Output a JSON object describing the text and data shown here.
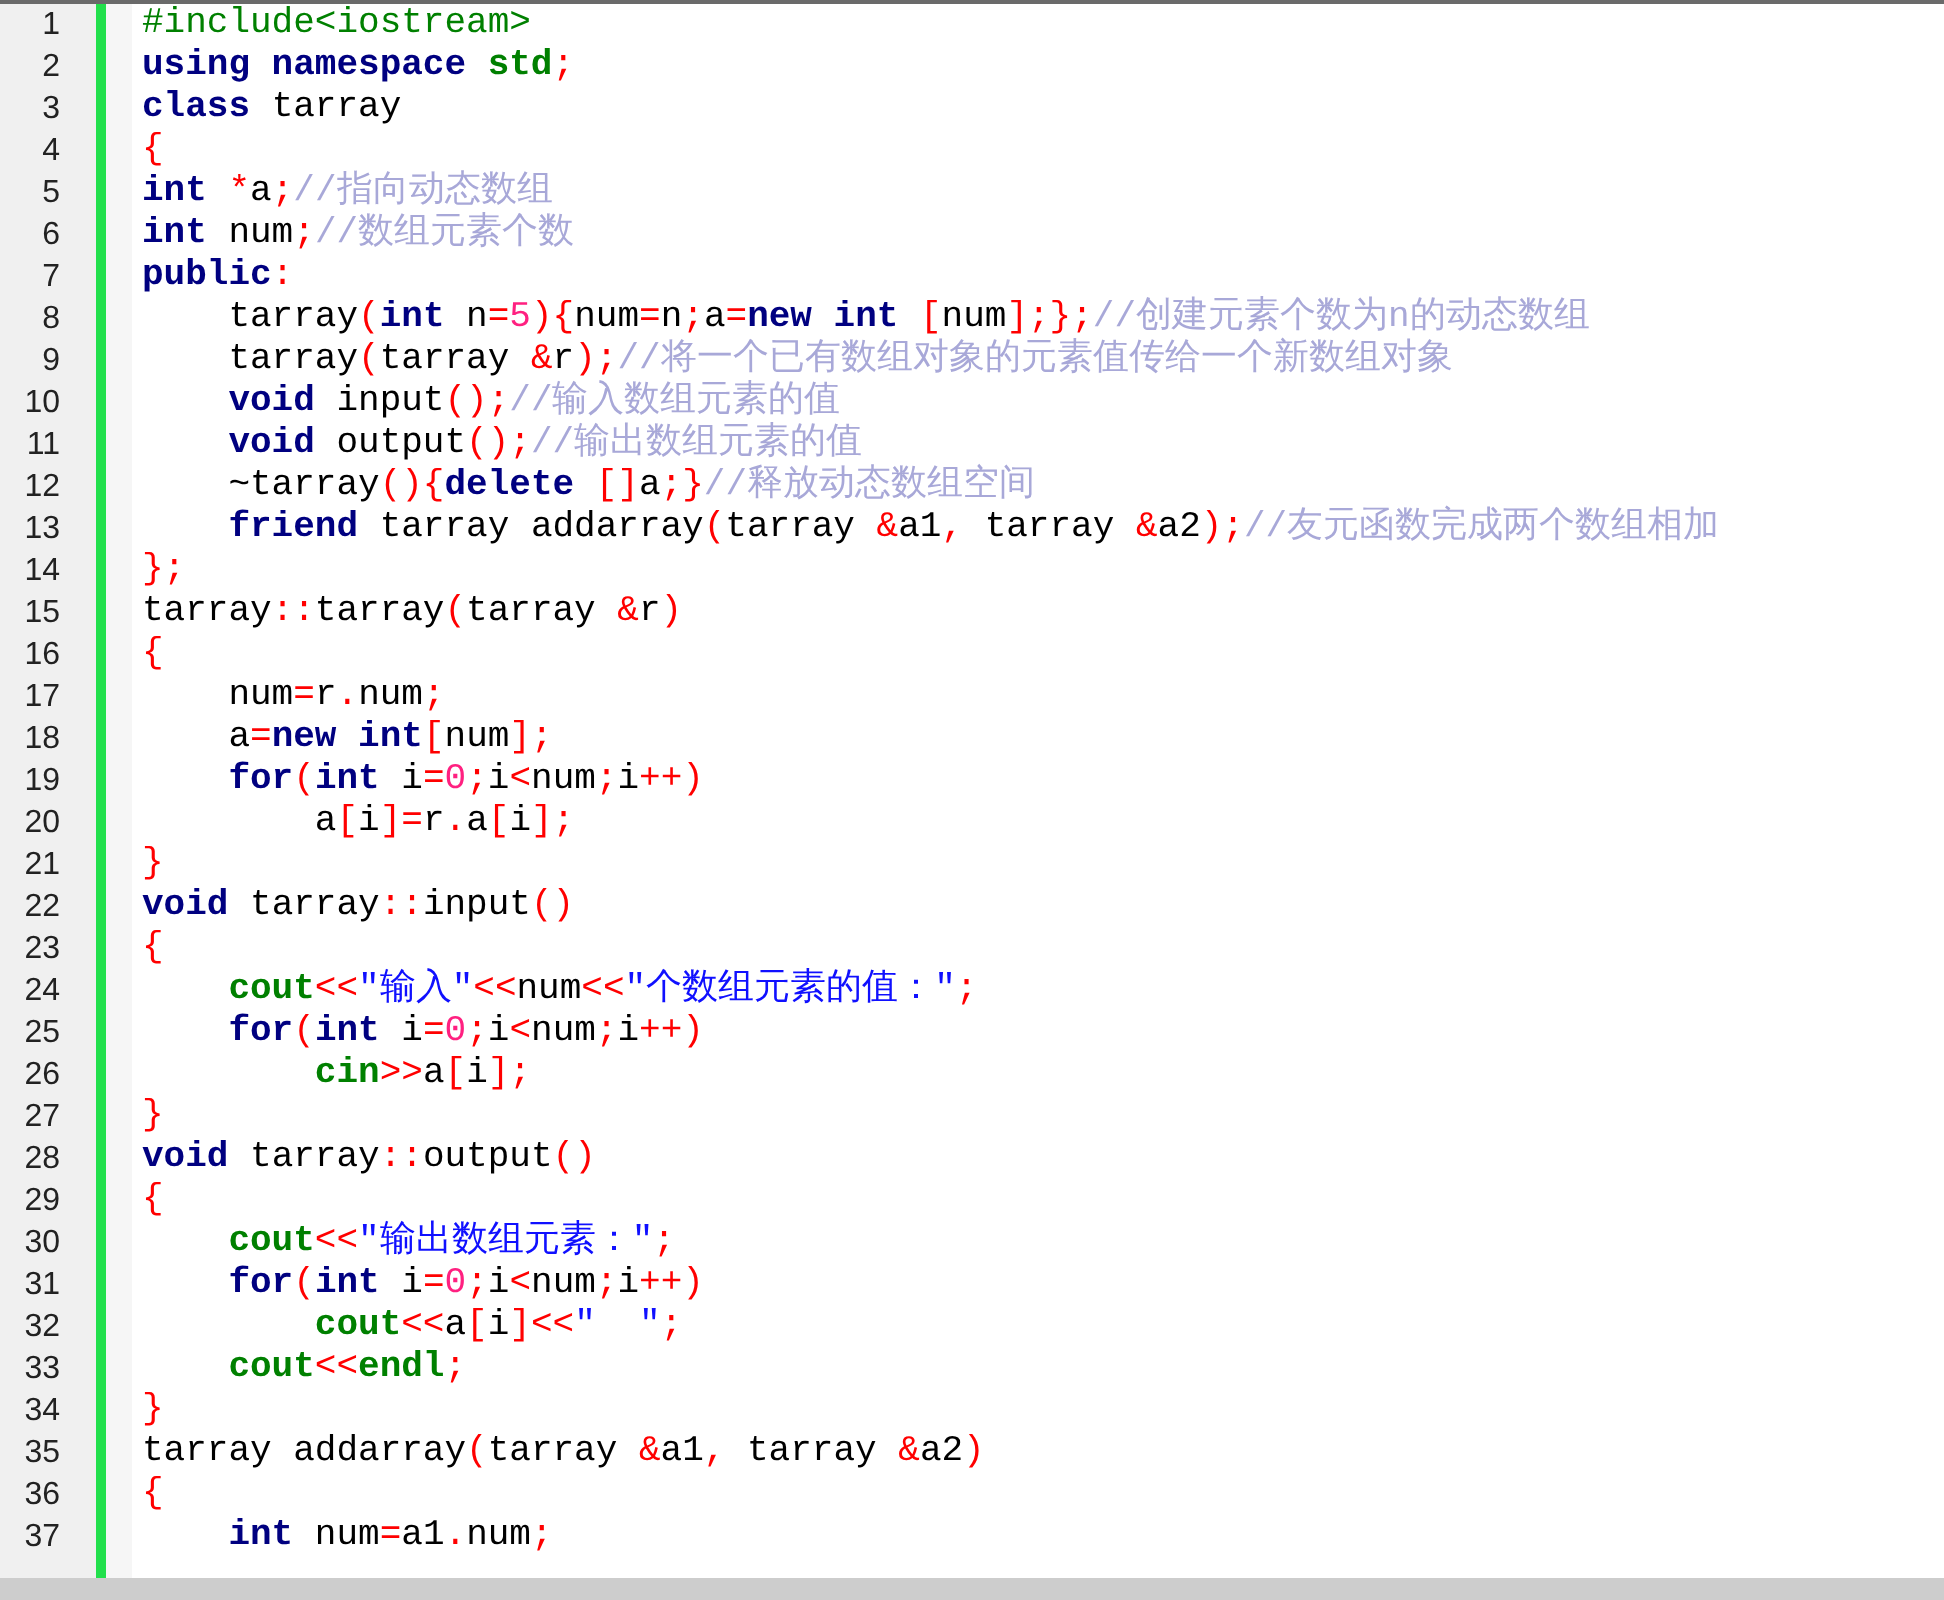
{
  "editor": {
    "lines": [
      {
        "number": "1",
        "tokens": [
          {
            "kind": "pre",
            "text": "#include<iostream>"
          }
        ]
      },
      {
        "number": "2",
        "tokens": [
          {
            "kind": "kw",
            "text": "using namespace "
          },
          {
            "kind": "lib",
            "text": "std"
          },
          {
            "kind": "op",
            "text": ";"
          }
        ]
      },
      {
        "number": "3",
        "tokens": [
          {
            "kind": "kw",
            "text": "class"
          },
          {
            "kind": "id",
            "text": " tarray"
          }
        ]
      },
      {
        "number": "4",
        "tokens": [
          {
            "kind": "op",
            "text": "{"
          }
        ]
      },
      {
        "number": "5",
        "tokens": [
          {
            "kind": "kw",
            "text": "int "
          },
          {
            "kind": "op",
            "text": "*"
          },
          {
            "kind": "id",
            "text": "a"
          },
          {
            "kind": "op",
            "text": ";"
          },
          {
            "kind": "cm",
            "text": "//指向动态数组"
          }
        ]
      },
      {
        "number": "6",
        "tokens": [
          {
            "kind": "kw",
            "text": "int"
          },
          {
            "kind": "id",
            "text": " num"
          },
          {
            "kind": "op",
            "text": ";"
          },
          {
            "kind": "cm",
            "text": "//数组元素个数"
          }
        ]
      },
      {
        "number": "7",
        "tokens": [
          {
            "kind": "kw",
            "text": "public"
          },
          {
            "kind": "op",
            "text": ":"
          }
        ]
      },
      {
        "number": "8",
        "tokens": [
          {
            "kind": "id",
            "text": "    tarray"
          },
          {
            "kind": "op",
            "text": "("
          },
          {
            "kind": "kw",
            "text": "int"
          },
          {
            "kind": "id",
            "text": " n"
          },
          {
            "kind": "op",
            "text": "="
          },
          {
            "kind": "num",
            "text": "5"
          },
          {
            "kind": "op",
            "text": "){"
          },
          {
            "kind": "id",
            "text": "num"
          },
          {
            "kind": "op",
            "text": "="
          },
          {
            "kind": "id",
            "text": "n"
          },
          {
            "kind": "op",
            "text": ";"
          },
          {
            "kind": "id",
            "text": "a"
          },
          {
            "kind": "op",
            "text": "="
          },
          {
            "kind": "kw",
            "text": "new int "
          },
          {
            "kind": "op",
            "text": "["
          },
          {
            "kind": "id",
            "text": "num"
          },
          {
            "kind": "op",
            "text": "];};"
          },
          {
            "kind": "cm",
            "text": "//创建元素个数为n的动态数组"
          }
        ]
      },
      {
        "number": "9",
        "tokens": [
          {
            "kind": "id",
            "text": "    tarray"
          },
          {
            "kind": "op",
            "text": "("
          },
          {
            "kind": "id",
            "text": "tarray "
          },
          {
            "kind": "op",
            "text": "&"
          },
          {
            "kind": "id",
            "text": "r"
          },
          {
            "kind": "op",
            "text": ");"
          },
          {
            "kind": "cm",
            "text": "//将一个已有数组对象的元素值传给一个新数组对象"
          }
        ]
      },
      {
        "number": "10",
        "tokens": [
          {
            "kind": "kw",
            "text": "    void"
          },
          {
            "kind": "id",
            "text": " input"
          },
          {
            "kind": "op",
            "text": "();"
          },
          {
            "kind": "cm",
            "text": "//输入数组元素的值"
          }
        ]
      },
      {
        "number": "11",
        "tokens": [
          {
            "kind": "kw",
            "text": "    void"
          },
          {
            "kind": "id",
            "text": " output"
          },
          {
            "kind": "op",
            "text": "();"
          },
          {
            "kind": "cm",
            "text": "//输出数组元素的值"
          }
        ]
      },
      {
        "number": "12",
        "tokens": [
          {
            "kind": "id",
            "text": "    ~tarray"
          },
          {
            "kind": "op",
            "text": "(){"
          },
          {
            "kind": "kw",
            "text": "delete "
          },
          {
            "kind": "op",
            "text": "[]"
          },
          {
            "kind": "id",
            "text": "a"
          },
          {
            "kind": "op",
            "text": ";}"
          },
          {
            "kind": "cm",
            "text": "//释放动态数组空间"
          }
        ]
      },
      {
        "number": "13",
        "tokens": [
          {
            "kind": "kw",
            "text": "    friend"
          },
          {
            "kind": "id",
            "text": " tarray addarray"
          },
          {
            "kind": "op",
            "text": "("
          },
          {
            "kind": "id",
            "text": "tarray "
          },
          {
            "kind": "op",
            "text": "&"
          },
          {
            "kind": "id",
            "text": "a1"
          },
          {
            "kind": "op",
            "text": ","
          },
          {
            "kind": "id",
            "text": " tarray "
          },
          {
            "kind": "op",
            "text": "&"
          },
          {
            "kind": "id",
            "text": "a2"
          },
          {
            "kind": "op",
            "text": ");"
          },
          {
            "kind": "cm",
            "text": "//友元函数完成两个数组相加"
          }
        ]
      },
      {
        "number": "14",
        "tokens": [
          {
            "kind": "op",
            "text": "};"
          }
        ]
      },
      {
        "number": "15",
        "tokens": [
          {
            "kind": "id",
            "text": "tarray"
          },
          {
            "kind": "op",
            "text": "::"
          },
          {
            "kind": "id",
            "text": "tarray"
          },
          {
            "kind": "op",
            "text": "("
          },
          {
            "kind": "id",
            "text": "tarray "
          },
          {
            "kind": "op",
            "text": "&"
          },
          {
            "kind": "id",
            "text": "r"
          },
          {
            "kind": "op",
            "text": ")"
          }
        ]
      },
      {
        "number": "16",
        "tokens": [
          {
            "kind": "op",
            "text": "{"
          }
        ]
      },
      {
        "number": "17",
        "tokens": [
          {
            "kind": "id",
            "text": "    num"
          },
          {
            "kind": "op",
            "text": "="
          },
          {
            "kind": "id",
            "text": "r"
          },
          {
            "kind": "op",
            "text": "."
          },
          {
            "kind": "id",
            "text": "num"
          },
          {
            "kind": "op",
            "text": ";"
          }
        ]
      },
      {
        "number": "18",
        "tokens": [
          {
            "kind": "id",
            "text": "    a"
          },
          {
            "kind": "op",
            "text": "="
          },
          {
            "kind": "kw",
            "text": "new int"
          },
          {
            "kind": "op",
            "text": "["
          },
          {
            "kind": "id",
            "text": "num"
          },
          {
            "kind": "op",
            "text": "];"
          }
        ]
      },
      {
        "number": "19",
        "tokens": [
          {
            "kind": "kw",
            "text": "    for"
          },
          {
            "kind": "op",
            "text": "("
          },
          {
            "kind": "kw",
            "text": "int"
          },
          {
            "kind": "id",
            "text": " i"
          },
          {
            "kind": "op",
            "text": "="
          },
          {
            "kind": "num",
            "text": "0"
          },
          {
            "kind": "op",
            "text": ";"
          },
          {
            "kind": "id",
            "text": "i"
          },
          {
            "kind": "op",
            "text": "<"
          },
          {
            "kind": "id",
            "text": "num"
          },
          {
            "kind": "op",
            "text": ";"
          },
          {
            "kind": "id",
            "text": "i"
          },
          {
            "kind": "op",
            "text": "++)"
          }
        ]
      },
      {
        "number": "20",
        "tokens": [
          {
            "kind": "id",
            "text": "        a"
          },
          {
            "kind": "op",
            "text": "["
          },
          {
            "kind": "id",
            "text": "i"
          },
          {
            "kind": "op",
            "text": "]="
          },
          {
            "kind": "id",
            "text": "r"
          },
          {
            "kind": "op",
            "text": "."
          },
          {
            "kind": "id",
            "text": "a"
          },
          {
            "kind": "op",
            "text": "["
          },
          {
            "kind": "id",
            "text": "i"
          },
          {
            "kind": "op",
            "text": "];"
          }
        ]
      },
      {
        "number": "21",
        "tokens": [
          {
            "kind": "op",
            "text": "}"
          }
        ]
      },
      {
        "number": "22",
        "tokens": [
          {
            "kind": "kw",
            "text": "void"
          },
          {
            "kind": "id",
            "text": " tarray"
          },
          {
            "kind": "op",
            "text": "::"
          },
          {
            "kind": "id",
            "text": "input"
          },
          {
            "kind": "op",
            "text": "()"
          }
        ]
      },
      {
        "number": "23",
        "tokens": [
          {
            "kind": "op",
            "text": "{"
          }
        ]
      },
      {
        "number": "24",
        "tokens": [
          {
            "kind": "lib",
            "text": "    cout"
          },
          {
            "kind": "op",
            "text": "<<"
          },
          {
            "kind": "str",
            "text": "\"输入\""
          },
          {
            "kind": "op",
            "text": "<<"
          },
          {
            "kind": "id",
            "text": "num"
          },
          {
            "kind": "op",
            "text": "<<"
          },
          {
            "kind": "str",
            "text": "\"个数组元素的值：\""
          },
          {
            "kind": "op",
            "text": ";"
          }
        ]
      },
      {
        "number": "25",
        "tokens": [
          {
            "kind": "kw",
            "text": "    for"
          },
          {
            "kind": "op",
            "text": "("
          },
          {
            "kind": "kw",
            "text": "int"
          },
          {
            "kind": "id",
            "text": " i"
          },
          {
            "kind": "op",
            "text": "="
          },
          {
            "kind": "num",
            "text": "0"
          },
          {
            "kind": "op",
            "text": ";"
          },
          {
            "kind": "id",
            "text": "i"
          },
          {
            "kind": "op",
            "text": "<"
          },
          {
            "kind": "id",
            "text": "num"
          },
          {
            "kind": "op",
            "text": ";"
          },
          {
            "kind": "id",
            "text": "i"
          },
          {
            "kind": "op",
            "text": "++)"
          }
        ]
      },
      {
        "number": "26",
        "tokens": [
          {
            "kind": "lib",
            "text": "        cin"
          },
          {
            "kind": "op",
            "text": ">>"
          },
          {
            "kind": "id",
            "text": "a"
          },
          {
            "kind": "op",
            "text": "["
          },
          {
            "kind": "id",
            "text": "i"
          },
          {
            "kind": "op",
            "text": "];"
          }
        ]
      },
      {
        "number": "27",
        "tokens": [
          {
            "kind": "op",
            "text": "}"
          }
        ]
      },
      {
        "number": "28",
        "tokens": [
          {
            "kind": "kw",
            "text": "void"
          },
          {
            "kind": "id",
            "text": " tarray"
          },
          {
            "kind": "op",
            "text": "::"
          },
          {
            "kind": "id",
            "text": "output"
          },
          {
            "kind": "op",
            "text": "()"
          }
        ]
      },
      {
        "number": "29",
        "tokens": [
          {
            "kind": "op",
            "text": "{"
          }
        ]
      },
      {
        "number": "30",
        "tokens": [
          {
            "kind": "lib",
            "text": "    cout"
          },
          {
            "kind": "op",
            "text": "<<"
          },
          {
            "kind": "str",
            "text": "\"输出数组元素：\""
          },
          {
            "kind": "op",
            "text": ";"
          }
        ]
      },
      {
        "number": "31",
        "tokens": [
          {
            "kind": "kw",
            "text": "    for"
          },
          {
            "kind": "op",
            "text": "("
          },
          {
            "kind": "kw",
            "text": "int"
          },
          {
            "kind": "id",
            "text": " i"
          },
          {
            "kind": "op",
            "text": "="
          },
          {
            "kind": "num",
            "text": "0"
          },
          {
            "kind": "op",
            "text": ";"
          },
          {
            "kind": "id",
            "text": "i"
          },
          {
            "kind": "op",
            "text": "<"
          },
          {
            "kind": "id",
            "text": "num"
          },
          {
            "kind": "op",
            "text": ";"
          },
          {
            "kind": "id",
            "text": "i"
          },
          {
            "kind": "op",
            "text": "++)"
          }
        ]
      },
      {
        "number": "32",
        "tokens": [
          {
            "kind": "lib",
            "text": "        cout"
          },
          {
            "kind": "op",
            "text": "<<"
          },
          {
            "kind": "id",
            "text": "a"
          },
          {
            "kind": "op",
            "text": "["
          },
          {
            "kind": "id",
            "text": "i"
          },
          {
            "kind": "op",
            "text": "]<<"
          },
          {
            "kind": "str",
            "text": "\"  \""
          },
          {
            "kind": "op",
            "text": ";"
          }
        ]
      },
      {
        "number": "33",
        "tokens": [
          {
            "kind": "lib",
            "text": "    cout"
          },
          {
            "kind": "op",
            "text": "<<"
          },
          {
            "kind": "lib",
            "text": "endl"
          },
          {
            "kind": "op",
            "text": ";"
          }
        ]
      },
      {
        "number": "34",
        "tokens": [
          {
            "kind": "op",
            "text": "}"
          }
        ]
      },
      {
        "number": "35",
        "tokens": [
          {
            "kind": "id",
            "text": "tarray addarray"
          },
          {
            "kind": "op",
            "text": "("
          },
          {
            "kind": "id",
            "text": "tarray "
          },
          {
            "kind": "op",
            "text": "&"
          },
          {
            "kind": "id",
            "text": "a1"
          },
          {
            "kind": "op",
            "text": ","
          },
          {
            "kind": "id",
            "text": " tarray "
          },
          {
            "kind": "op",
            "text": "&"
          },
          {
            "kind": "id",
            "text": "a2"
          },
          {
            "kind": "op",
            "text": ")"
          }
        ]
      },
      {
        "number": "36",
        "tokens": [
          {
            "kind": "op",
            "text": "{"
          }
        ]
      },
      {
        "number": "37",
        "tokens": [
          {
            "kind": "kw",
            "text": "    int"
          },
          {
            "kind": "id",
            "text": " num"
          },
          {
            "kind": "op",
            "text": "="
          },
          {
            "kind": "id",
            "text": "a1"
          },
          {
            "kind": "op",
            "text": "."
          },
          {
            "kind": "id",
            "text": "num"
          },
          {
            "kind": "op",
            "text": ";"
          }
        ]
      }
    ]
  }
}
